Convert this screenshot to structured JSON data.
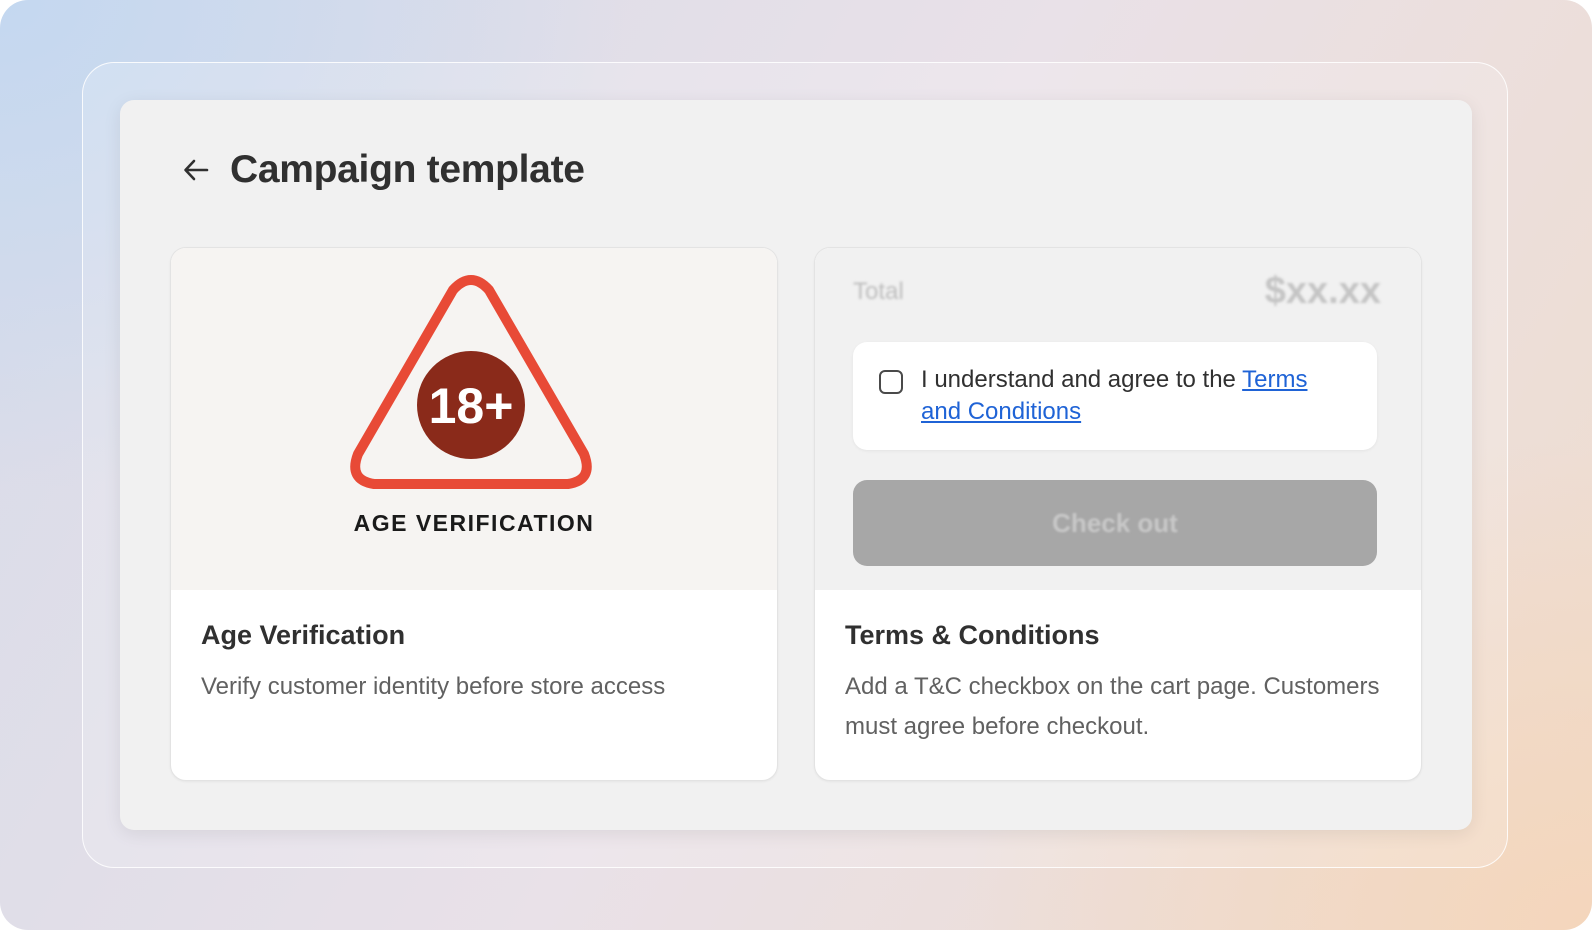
{
  "header": {
    "title": "Campaign template",
    "back_icon": "arrow-left-icon"
  },
  "templates": [
    {
      "preview": {
        "badge_text": "18+",
        "caption": "AGE VERIFICATION",
        "colors": {
          "triangle": "#e84a36",
          "circle": "#8a2a1a"
        }
      },
      "title": "Age Verification",
      "description": "Verify customer identity before store access"
    },
    {
      "preview": {
        "total_label": "Total",
        "total_amount": "$xx.xx",
        "checkbox_text": "I understand and agree to the ",
        "link_text": "Terms and Conditions",
        "checkout_label": "Check out",
        "colors": {
          "link": "#1f63d6",
          "button": "#a7a7a7"
        }
      },
      "title": "Terms & Conditions",
      "description": "Add a T&C checkbox on the cart page. Customers must agree before checkout."
    }
  ]
}
